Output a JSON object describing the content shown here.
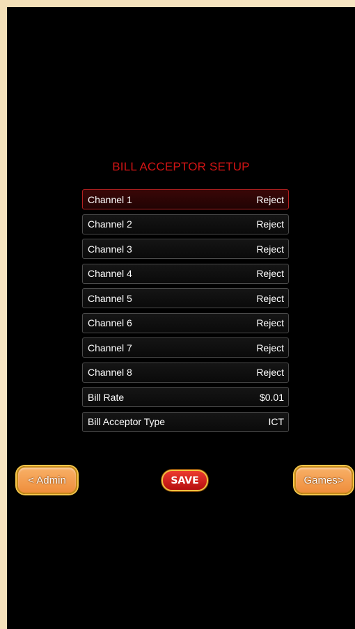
{
  "title": "BILL ACCEPTOR SETUP",
  "rows": [
    {
      "label": "Channel 1",
      "value": "Reject"
    },
    {
      "label": "Channel 2",
      "value": "Reject"
    },
    {
      "label": "Channel 3",
      "value": "Reject"
    },
    {
      "label": "Channel 4",
      "value": "Reject"
    },
    {
      "label": "Channel 5",
      "value": "Reject"
    },
    {
      "label": "Channel 6",
      "value": "Reject"
    },
    {
      "label": "Channel 7",
      "value": "Reject"
    },
    {
      "label": "Channel 8",
      "value": "Reject"
    },
    {
      "label": "Bill Rate",
      "value": "$0.01"
    },
    {
      "label": "Bill Acceptor Type",
      "value": "ICT"
    }
  ],
  "selected_row": "Channel 1",
  "buttons": {
    "admin": "< Admin",
    "save": "SAVE",
    "games": "Games>"
  },
  "colors": {
    "title": "#d11414",
    "selected_row_border": "#b32020",
    "nav_button": "#ef8e3c",
    "save_button": "#d01f1a"
  }
}
